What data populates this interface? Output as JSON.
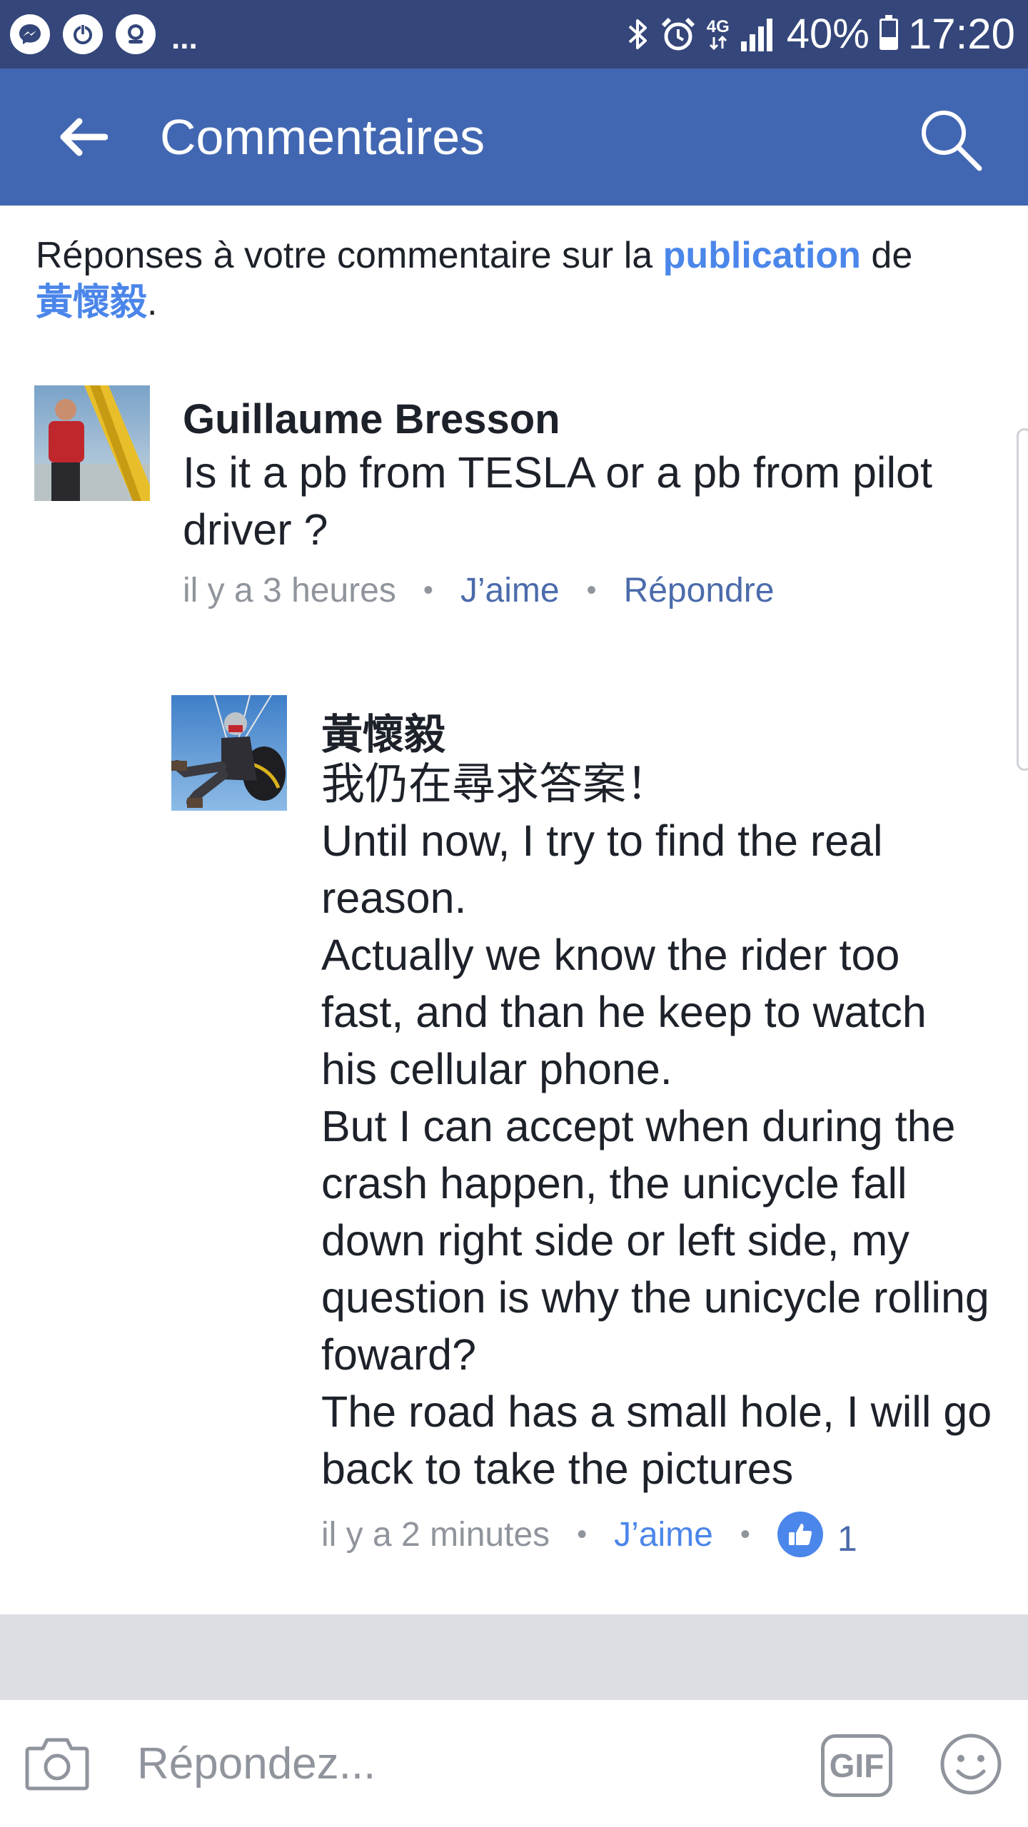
{
  "status_bar": {
    "left_icons": [
      "messenger-icon",
      "power-icon",
      "messenger-bot-icon"
    ],
    "more": "...",
    "network": "4G",
    "battery_pct": "40%",
    "battery_level": 0.4,
    "time": "17:20"
  },
  "app_bar": {
    "title": "Commentaires",
    "back_icon": "arrow-left-icon",
    "search_icon": "search-icon"
  },
  "context": {
    "text_before": "Réponses à votre commentaire sur la ",
    "link": "publication",
    "text_middle": " de ",
    "author_link": "黃懷毅",
    "text_after": "."
  },
  "comments": [
    {
      "author": "Guillaume Bresson",
      "text": "Is it a pb from TESLA or a pb from pilot driver ?",
      "time": "il y a 3 heures",
      "like": "J’aime",
      "reply": "Répondre"
    },
    {
      "author": "黃懷毅",
      "text": "我仍在尋求答案！\nUntil now,  I try to find the real reason.\nActually  we know the rider too fast, and than he keep to watch his cellular phone.\nBut I can accept when during the crash happen, the unicycle fall down right side or left side, my question is why the unicycle rolling foward?\nThe road has a small hole, I will go back to take the pictures",
      "time": "il y a 2 minutes",
      "like": "J’aime",
      "like_count": "1"
    }
  ],
  "composer": {
    "placeholder": "Répondez...",
    "gif_label": "GIF",
    "camera_icon": "camera-icon",
    "emoji_icon": "smiley-icon"
  },
  "colors": {
    "status_bar": "#34467a",
    "app_bar": "#4267b2",
    "link": "#4b86ea",
    "meta": "#90949c"
  }
}
